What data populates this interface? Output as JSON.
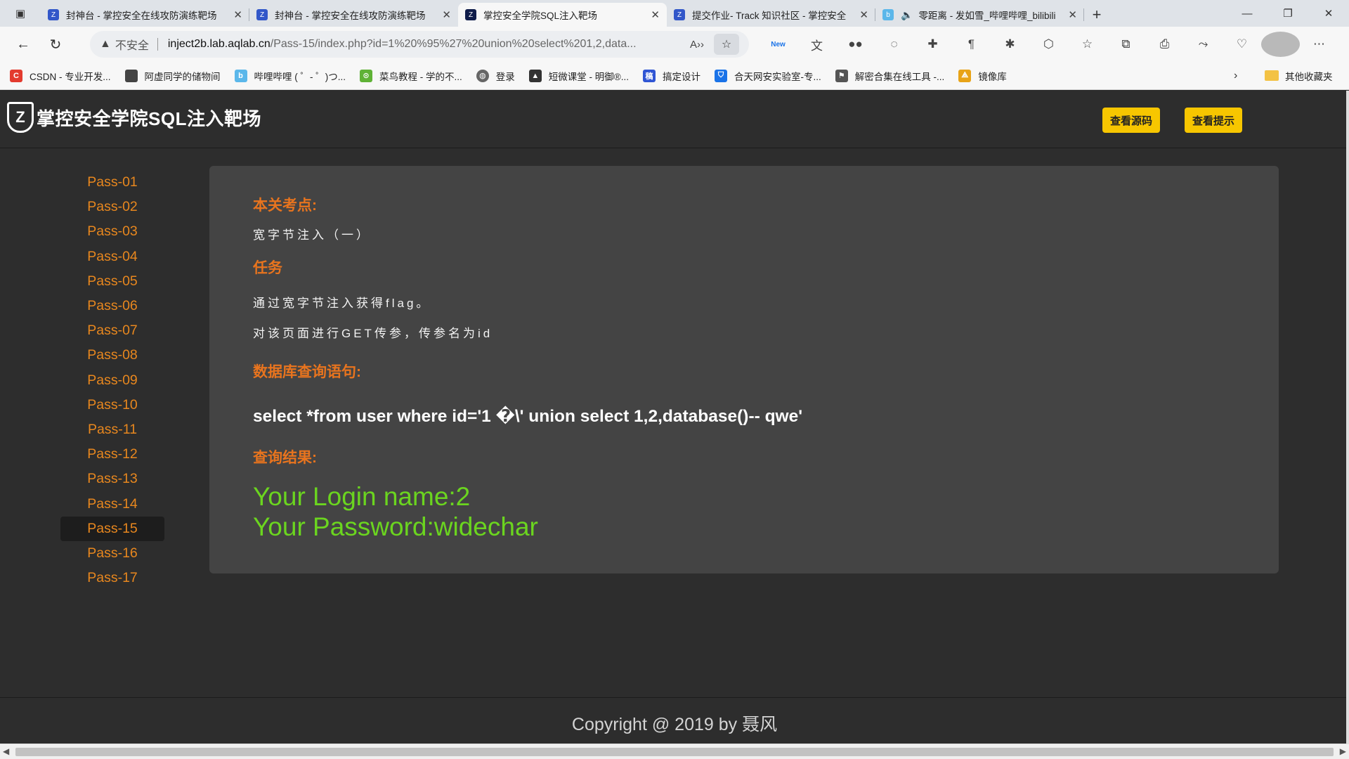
{
  "browser": {
    "tabs": [
      {
        "title": "封神台 - 掌控安全在线攻防演练靶场",
        "icon": "shield-icon",
        "active": false
      },
      {
        "title": "封神台 - 掌控安全在线攻防演练靶场",
        "icon": "shield-icon",
        "active": false
      },
      {
        "title": "掌控安全学院SQL注入靶场",
        "icon": "shield-icon",
        "active": true
      },
      {
        "title": "提交作业- Track 知识社区 - 掌控安全",
        "icon": "shield-icon",
        "active": false
      },
      {
        "title": "零距离 - 发如雪_哔哩哔哩_bilibili",
        "icon": "bilibili-icon",
        "active": false
      }
    ],
    "address": {
      "security_label": "不安全",
      "host": "inject2b.lab.aqlab.cn",
      "path": "/Pass-15/index.php?id=1%20%95%27%20union%20select%201,2,data..."
    },
    "ext_new_label": "New",
    "bookmarks": [
      {
        "label": "CSDN - 专业开发...",
        "icon": "csdn-icon",
        "color": "#e33b2e"
      },
      {
        "label": "阿虚同学的储物间",
        "icon": "box-icon",
        "color": "#444444"
      },
      {
        "label": "哔哩哔哩 ( ゜- ゜)つ...",
        "icon": "bilibili-icon",
        "color": "#5bb7ea"
      },
      {
        "label": "菜鸟教程 - 学的不...",
        "icon": "runoob-icon",
        "color": "#5fb236"
      },
      {
        "label": "登录",
        "icon": "globe-icon",
        "color": "#666666"
      },
      {
        "label": "短微课堂 - 明御®...",
        "icon": "hat-icon",
        "color": "#333333"
      },
      {
        "label": "搞定设计",
        "icon": "design-icon",
        "color": "#2f55d4"
      },
      {
        "label": "合天网安实验室-专...",
        "icon": "shield-icon",
        "color": "#1a73e8"
      },
      {
        "label": "解密合集在线工具 -...",
        "icon": "flag-icon",
        "color": "#555555"
      },
      {
        "label": "镜像库",
        "icon": "mirror-icon",
        "color": "#e8a317"
      }
    ],
    "bookmarks_other": "其他收藏夹"
  },
  "page": {
    "logo_mark": "Z",
    "site_title": "掌控安全学院SQL注入靶场",
    "btn_view_source": "查看源码",
    "btn_view_hint": "查看提示",
    "sidebar": [
      "Pass-01",
      "Pass-02",
      "Pass-03",
      "Pass-04",
      "Pass-05",
      "Pass-06",
      "Pass-07",
      "Pass-08",
      "Pass-09",
      "Pass-10",
      "Pass-11",
      "Pass-12",
      "Pass-13",
      "Pass-14",
      "Pass-15",
      "Pass-16",
      "Pass-17"
    ],
    "sidebar_active": "Pass-15",
    "panel": {
      "topic_heading": "本关考点:",
      "topic_text": "宽字节注入（一）",
      "task_heading": "任务",
      "task_line1": "通过宽字节注入获得flag。",
      "task_line2": "对该页面进行GET传参，传参名为id",
      "query_heading": "数据库查询语句:",
      "query_text": "select *from user where id='1 �\\' union select 1,2,database()-- qwe'",
      "result_heading": "查询结果:",
      "result_line1": "Your Login name:2",
      "result_line2": "Your Password:widechar"
    },
    "footer": "Copyright @ 2019 by 聂风"
  }
}
